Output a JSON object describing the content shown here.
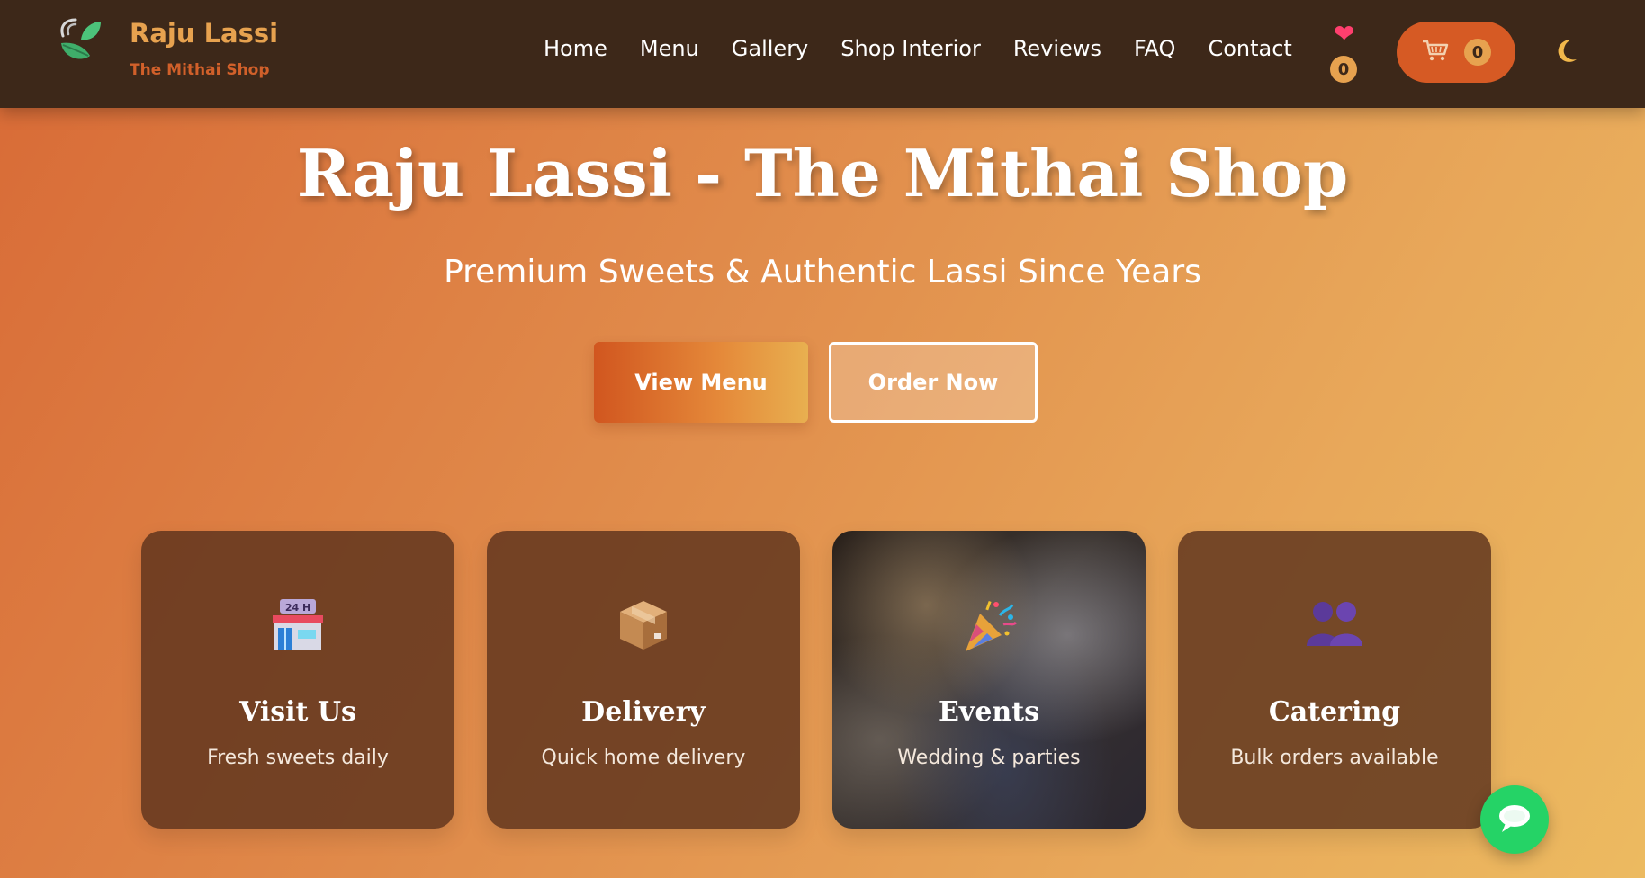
{
  "brand": {
    "name": "Raju Lassi",
    "subtitle": "The Mithai Shop",
    "logo_icon": "leaf-logo-icon"
  },
  "nav": {
    "items": [
      {
        "label": "Home"
      },
      {
        "label": "Menu"
      },
      {
        "label": "Gallery"
      },
      {
        "label": "Shop Interior"
      },
      {
        "label": "Reviews"
      },
      {
        "label": "FAQ"
      },
      {
        "label": "Contact"
      }
    ],
    "wishlist": {
      "icon": "heart-icon",
      "count": "0"
    },
    "cart": {
      "icon": "cart-icon",
      "count": "0"
    },
    "theme_toggle_icon": "moon-icon"
  },
  "hero": {
    "title": "Raju Lassi - The Mithai Shop",
    "subtitle": "Premium Sweets & Authentic Lassi Since Years",
    "primary_button": "View Menu",
    "secondary_button": "Order Now"
  },
  "features": [
    {
      "icon": "store-24h-icon",
      "title": "Visit Us",
      "text": "Fresh sweets daily"
    },
    {
      "icon": "package-icon",
      "title": "Delivery",
      "text": "Quick home delivery"
    },
    {
      "icon": "party-popper-icon",
      "title": "Events",
      "text": "Wedding & parties"
    },
    {
      "icon": "people-icon",
      "title": "Catering",
      "text": "Bulk orders available"
    }
  ],
  "chat": {
    "icon": "chat-bubble-icon"
  },
  "colors": {
    "navbar": "#3d2819",
    "brand_gold": "#e7a24f",
    "brand_orange": "#d1602a",
    "cart_button": "#d65a24",
    "chat_green": "#25d366"
  }
}
